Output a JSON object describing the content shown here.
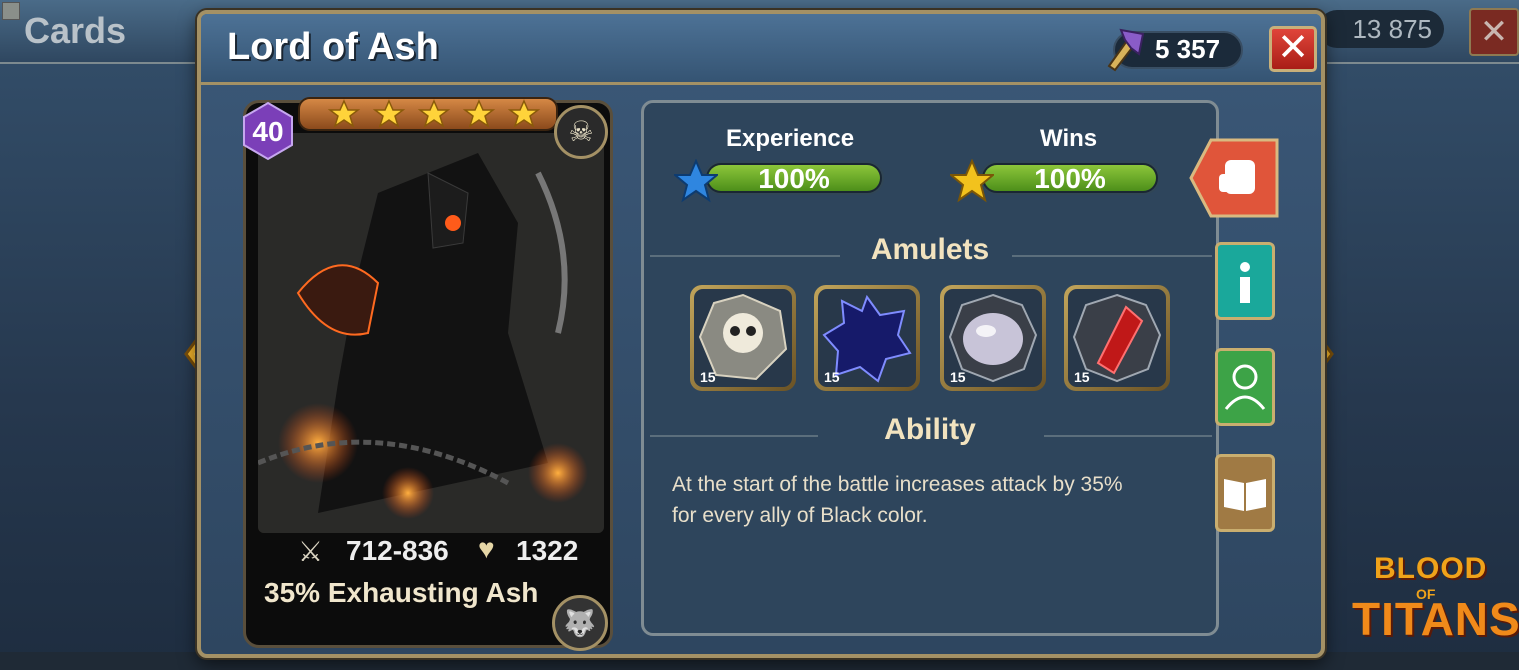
{
  "background": {
    "title": "Cards",
    "currency": "13 875"
  },
  "dialog": {
    "title": "Lord of Ash",
    "gold": "5 357"
  },
  "card": {
    "level": "40",
    "stars": 5,
    "attack": "712-836",
    "health": "1322",
    "ability_short": "35% Exhausting Ash"
  },
  "progress": {
    "experience_label": "Experience",
    "experience_value": "100%",
    "experience_fraction": 1.0,
    "wins_label": "Wins",
    "wins_value": "100%",
    "wins_fraction": 1.0
  },
  "amulets": {
    "title": "Amulets",
    "items": [
      {
        "level": "15",
        "icon": "skull-gear-amulet-icon"
      },
      {
        "level": "15",
        "icon": "dark-blue-gem-amulet-icon"
      },
      {
        "level": "15",
        "icon": "pearl-amulet-icon"
      },
      {
        "level": "15",
        "icon": "red-crystal-amulet-icon"
      }
    ]
  },
  "ability": {
    "title": "Ability",
    "text_line1": "At the start of the battle increases attack by 35%",
    "text_line2": "for every ally of Black color."
  },
  "logo": {
    "line1": "BLOOD",
    "line2": "OF",
    "line3": "TITANS"
  },
  "colors": {
    "gold_border": "#a49165",
    "bar_green": "#6aa92a",
    "close_red": "#c9302a",
    "fight_orange": "#e0553a",
    "info_teal": "#1aa89b",
    "team_green": "#3da347"
  }
}
